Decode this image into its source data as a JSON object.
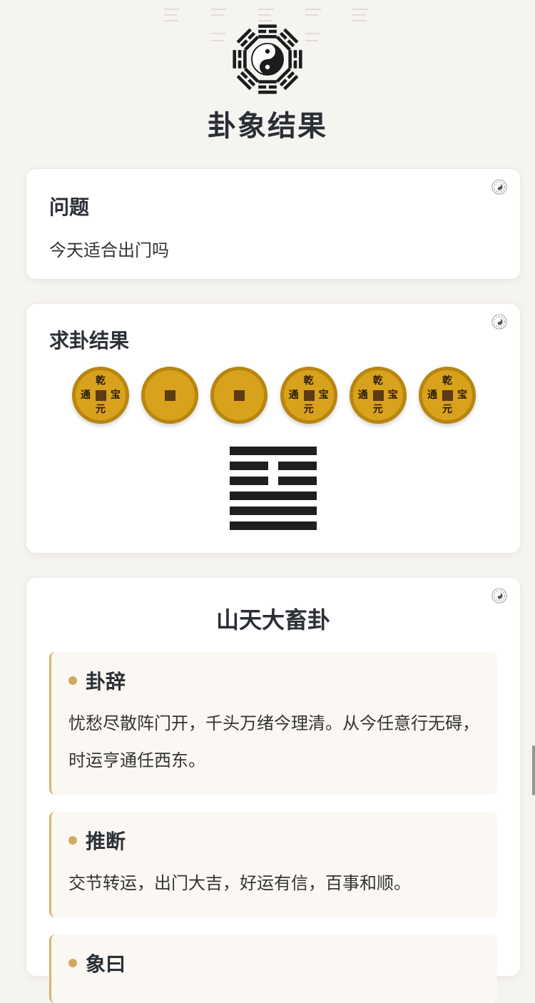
{
  "page": {
    "title": "卦象结果"
  },
  "question": {
    "heading": "问题",
    "text": "今天适合出门吗"
  },
  "result": {
    "heading": "求卦结果",
    "coins": [
      {
        "face": "text",
        "top": "乾",
        "bottom": "元",
        "left": "通",
        "right": "宝"
      },
      {
        "face": "blank"
      },
      {
        "face": "blank"
      },
      {
        "face": "text",
        "top": "乾",
        "bottom": "元",
        "left": "通",
        "right": "宝"
      },
      {
        "face": "text",
        "top": "乾",
        "bottom": "元",
        "left": "通",
        "right": "宝"
      },
      {
        "face": "text",
        "top": "乾",
        "bottom": "元",
        "left": "通",
        "right": "宝"
      }
    ],
    "hexagram_lines_top_to_bottom": [
      "yang",
      "yin",
      "yin",
      "yang",
      "yang",
      "yang"
    ]
  },
  "interpretation": {
    "name": "山天大畜卦",
    "sections": [
      {
        "heading": "卦辞",
        "text": "忧愁尽散阵门开，千头万绪今理清。从今任意行无碍，时运亨通任西东。"
      },
      {
        "heading": "推断",
        "text": "交节转运，出门大吉，好运有信，百事和顺。"
      },
      {
        "heading": "象曰",
        "text": ""
      }
    ]
  },
  "icons": {
    "header": "bagua-icon",
    "card_badge": "taiji-icon"
  },
  "colors": {
    "coin": "#d9a21c",
    "accent": "#d2aa5e",
    "background": "#f6f4f1"
  }
}
